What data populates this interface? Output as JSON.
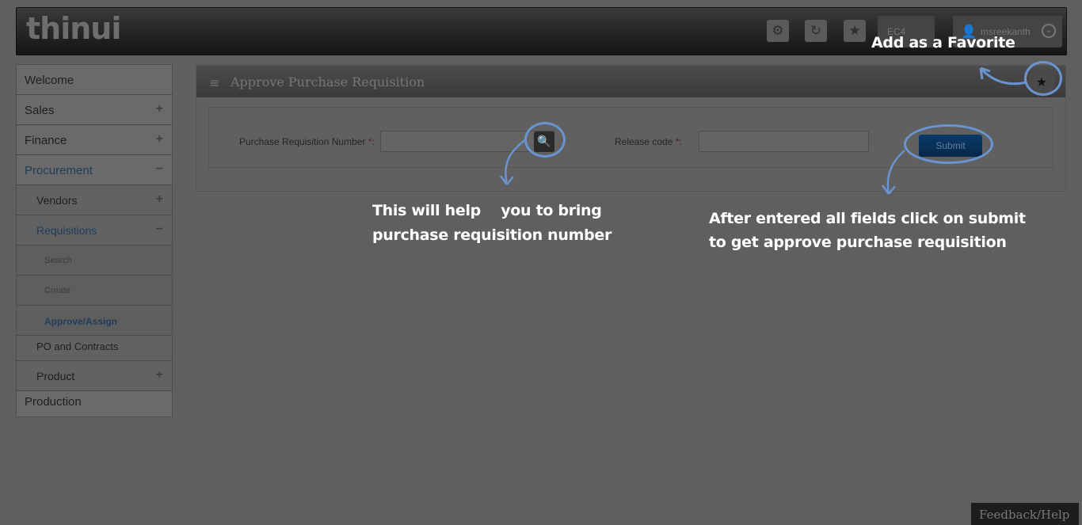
{
  "header": {
    "logo": "thinui",
    "company": "EC4",
    "user": "msreekanth"
  },
  "sidebar": {
    "items": [
      {
        "label": "Welcome"
      },
      {
        "label": "Sales",
        "toggle": "+"
      },
      {
        "label": "Finance",
        "toggle": "+"
      },
      {
        "label": "Procurement",
        "toggle": "−"
      },
      {
        "label": "Vendors",
        "toggle": "+"
      },
      {
        "label": "Requisitions",
        "toggle": "−"
      },
      {
        "label": "Search"
      },
      {
        "label": "Create"
      },
      {
        "label": "Approve/Assign"
      },
      {
        "label": "PO and Contracts"
      },
      {
        "label": "Product",
        "toggle": "+"
      },
      {
        "label": "Production"
      }
    ]
  },
  "panel": {
    "title": "Approve Purchase Requisition",
    "pr_label": "Purchase Requisition Number",
    "release_label": "Release code",
    "required_mark": "*",
    "colon": ":",
    "pr_value": "",
    "release_value": "",
    "submit_label": "Submit"
  },
  "annotations": {
    "favorite": "Add as a Favorite",
    "lookup_line1": "This will help    you to bring",
    "lookup_line2": "purchase requisition number",
    "submit_line1": "After entered all fields click on submit",
    "submit_line2": "to get approve purchase requisition"
  },
  "footer": {
    "feedback": "Feedback/Help"
  },
  "colors": {
    "overlay_ring": "#6a94d0",
    "submit_blue": "#0b3a68"
  }
}
